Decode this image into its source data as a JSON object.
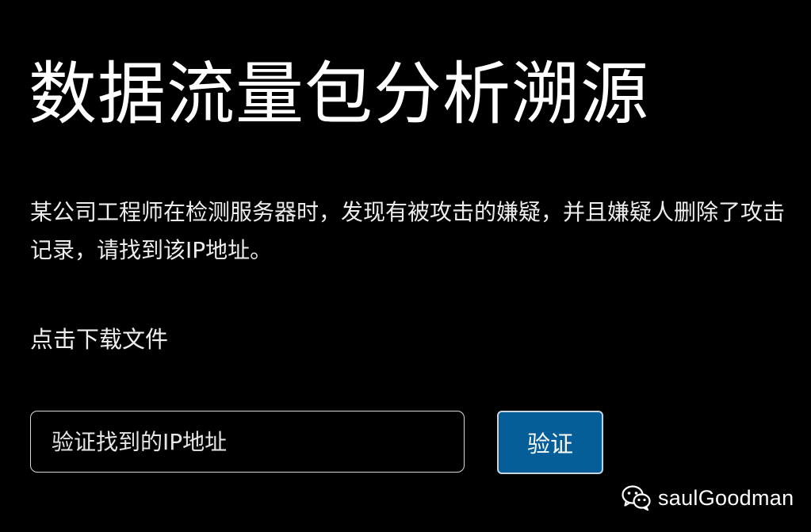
{
  "challenge": {
    "title": "数据流量包分析溯源",
    "description": "某公司工程师在检测服务器时，发现有被攻击的嫌疑，并且嫌疑人删除了攻击记录，请找到该IP地址。",
    "download_label": "点击下载文件"
  },
  "answer_form": {
    "input_placeholder": "验证找到的IP地址",
    "input_value": "",
    "submit_label": "验证"
  },
  "watermark": {
    "icon": "wechat-icon",
    "text": "saulGoodman"
  },
  "colors": {
    "background": "#000000",
    "text": "#ffffff",
    "button": "#055e97",
    "input_border": "#d9d9d9"
  }
}
